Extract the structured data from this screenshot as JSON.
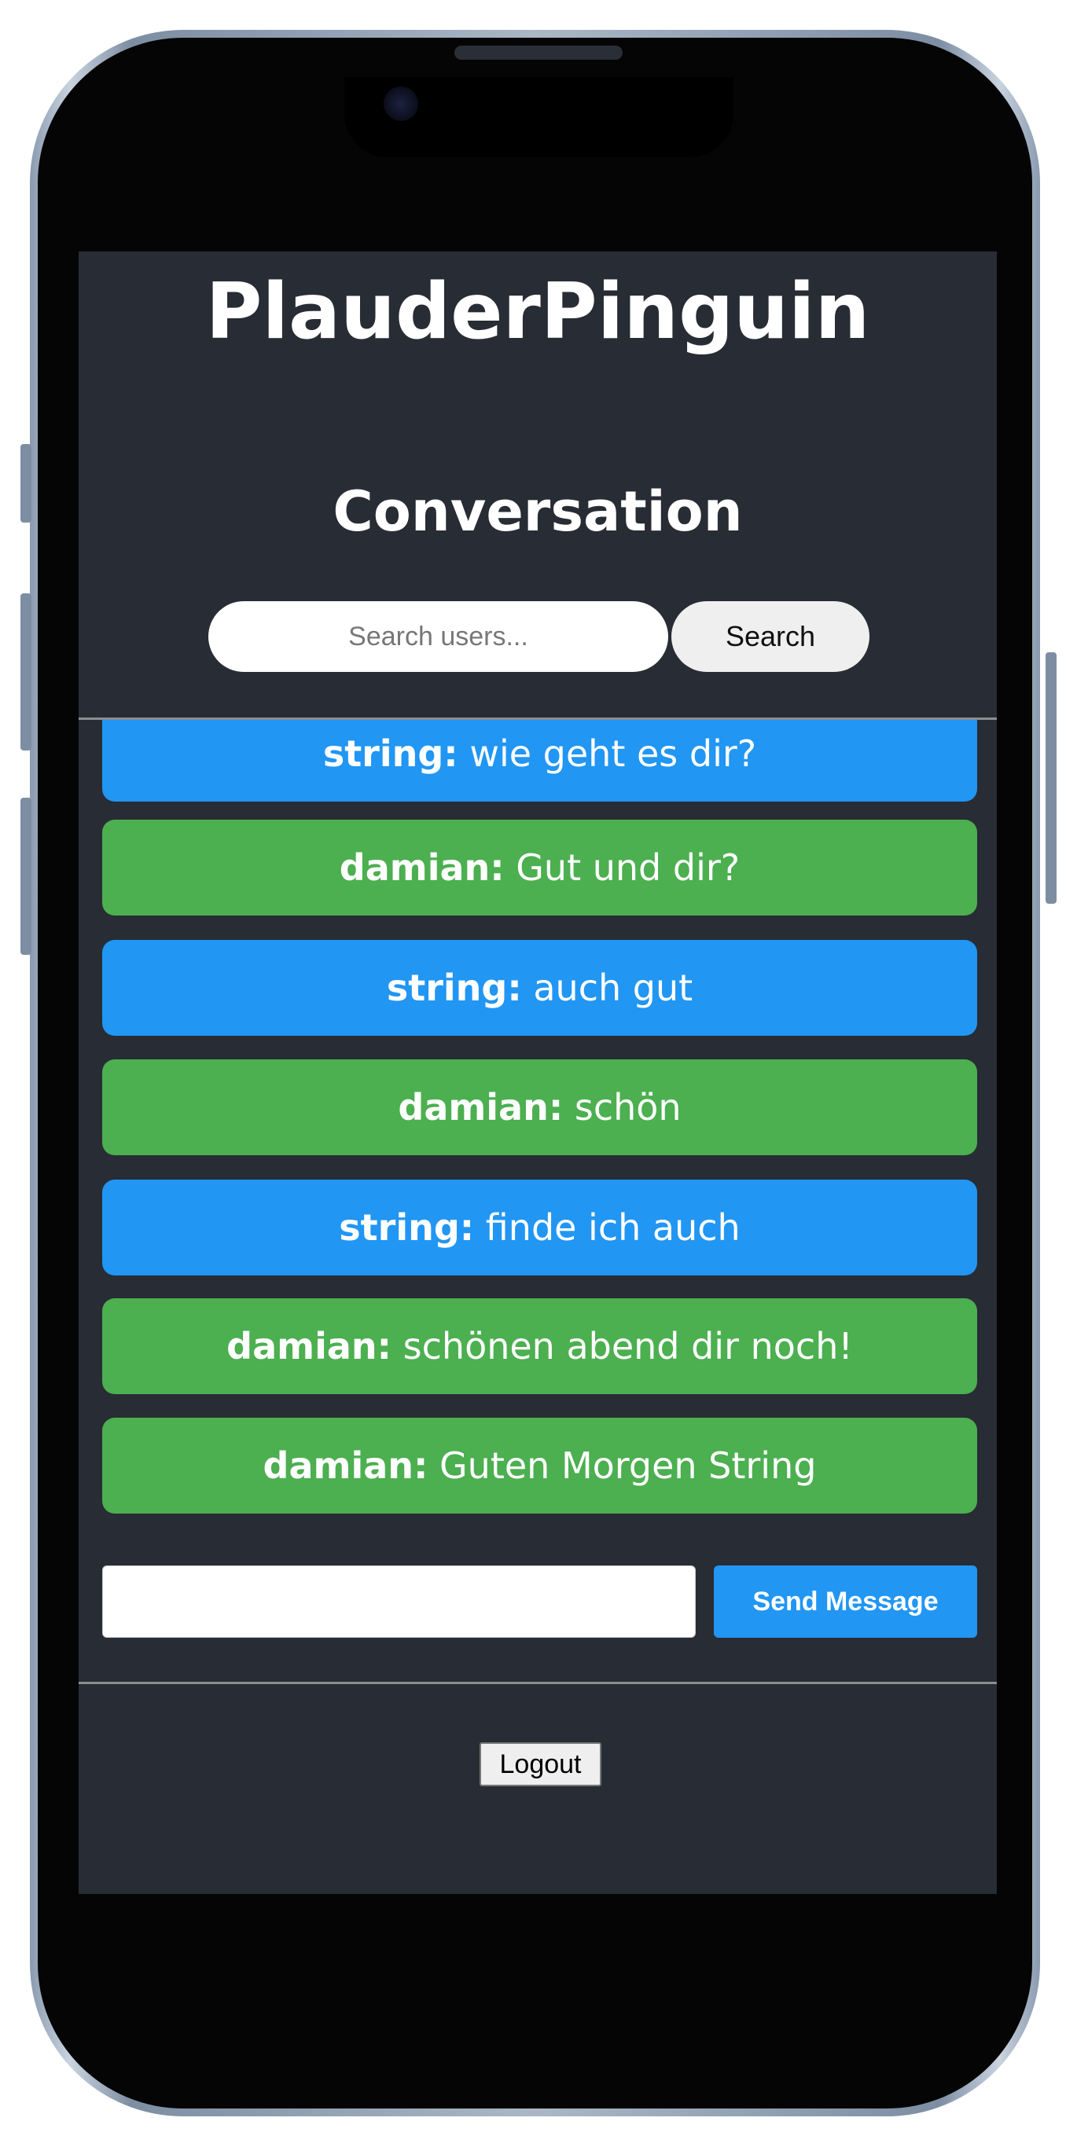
{
  "app": {
    "title": "PlauderPinguin"
  },
  "conversation": {
    "heading": "Conversation"
  },
  "search": {
    "placeholder": "Search users...",
    "button_label": "Search"
  },
  "messages": [
    {
      "sender": "string:",
      "text": " wie geht es dir?",
      "color": "#2196f3"
    },
    {
      "sender": "damian:",
      "text": " Gut und dir?",
      "color": "#4caf50"
    },
    {
      "sender": "string:",
      "text": " auch gut",
      "color": "#2196f3"
    },
    {
      "sender": "damian:",
      "text": " schön",
      "color": "#4caf50"
    },
    {
      "sender": "string:",
      "text": " finde ich auch",
      "color": "#2196f3"
    },
    {
      "sender": "damian:",
      "text": " schönen abend dir noch!",
      "color": "#4caf50"
    },
    {
      "sender": "damian:",
      "text": " Guten Morgen String",
      "color": "#4caf50"
    }
  ],
  "composer": {
    "value": "",
    "send_label": "Send Message"
  },
  "footer": {
    "logout_label": "Logout"
  },
  "colors": {
    "background": "#282c34",
    "accent": "#2196f3",
    "peer": "#4caf50"
  }
}
